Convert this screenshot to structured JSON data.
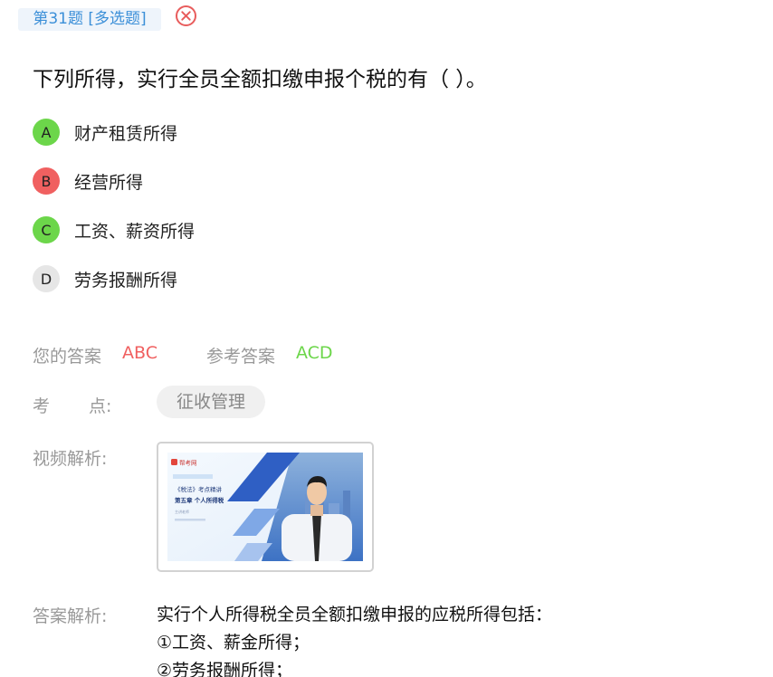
{
  "question": {
    "tag": "第31题 [多选题]",
    "text": "下列所得，实行全员全额扣缴申报个税的有（ ）。"
  },
  "options": [
    {
      "letter": "A",
      "text": "财产租赁所得",
      "color": "#6cd64a",
      "state": "correct"
    },
    {
      "letter": "B",
      "text": "经营所得",
      "color": "#f06060",
      "state": "wrong"
    },
    {
      "letter": "C",
      "text": "工资、薪资所得",
      "color": "#6cd64a",
      "state": "correct"
    },
    {
      "letter": "D",
      "text": "劳务报酬所得",
      "color": "#e6e6e6",
      "state": "unselected"
    }
  ],
  "answer": {
    "your_label": "您的答案",
    "your_value": "ABC",
    "your_color": "#f06060",
    "ref_label": "参考答案",
    "ref_value": "ACD",
    "ref_color": "#6cd64a"
  },
  "knowledge": {
    "label_1": "考",
    "label_2": "点:",
    "tag": "征收管理"
  },
  "video": {
    "label": "视频解析:",
    "logo": "帮考网",
    "line1": "《税法》考点精讲",
    "line2": "第五章 个人所得税",
    "line3": "主讲老师"
  },
  "explanation": {
    "label": "答案解析:",
    "lines": [
      "实行个人所得税全员全额扣缴申报的应税所得包括：",
      "①工资、薪金所得；",
      "②劳务报酬所得；"
    ]
  },
  "icons": {
    "close": "close-circle-icon"
  }
}
